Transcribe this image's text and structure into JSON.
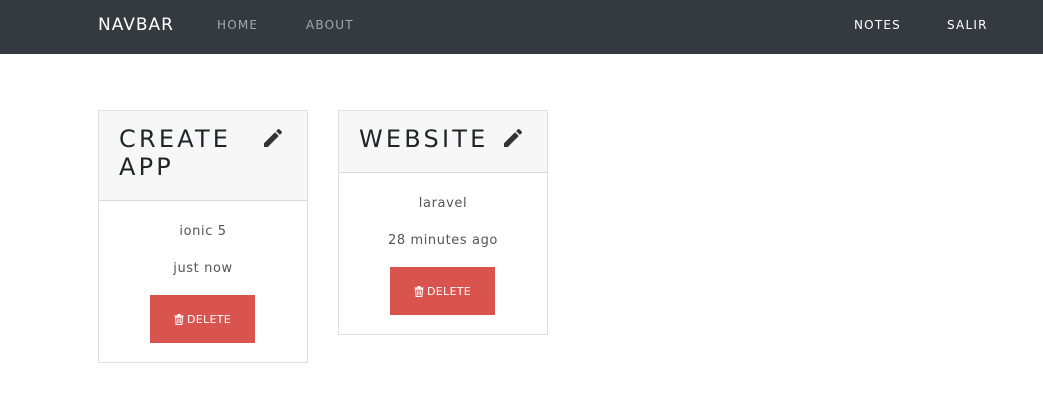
{
  "navbar": {
    "brand": "NAVBAR",
    "links": {
      "home": "HOME",
      "about": "ABOUT",
      "notes": "NOTES",
      "salir": "SALIR"
    }
  },
  "notes": [
    {
      "title": "CREATE APP",
      "content": "ionic 5",
      "time": "just now",
      "delete_label": "DELETE"
    },
    {
      "title": "WEBSITE",
      "content": "laravel",
      "time": "28 minutes ago",
      "delete_label": "DELETE"
    }
  ],
  "icons": {
    "edit": "pencil-icon",
    "delete": "trash-icon"
  },
  "colors": {
    "navbar_bg": "#343a40",
    "delete_btn": "#d9534f",
    "card_header_bg": "#f7f7f7"
  }
}
